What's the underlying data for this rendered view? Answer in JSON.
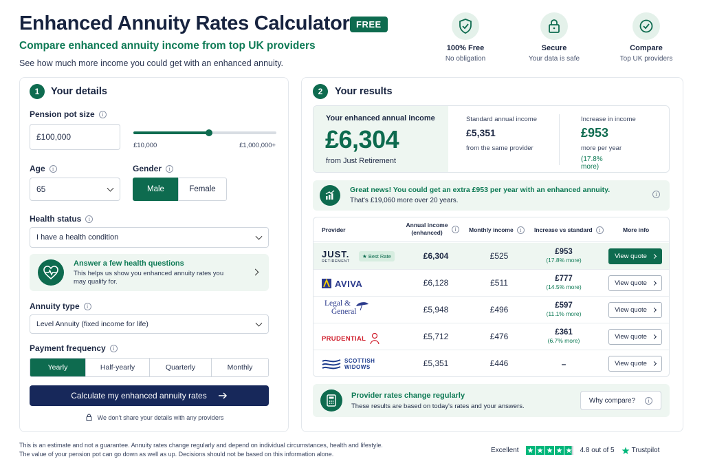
{
  "header": {
    "title": "Enhanced Annuity Rates Calculator",
    "free_badge": "FREE",
    "subtitle": "Compare enhanced annuity income from top UK providers",
    "tagline": "See how much more income you could get with an enhanced annuity."
  },
  "features": [
    {
      "title": "100% Free",
      "subtitle": "No obligation",
      "icon": "shield-check-icon"
    },
    {
      "title": "Secure",
      "subtitle": "Your data is safe",
      "icon": "lock-icon"
    },
    {
      "title": "Compare",
      "subtitle": "Top UK providers",
      "icon": "check-circle-icon"
    }
  ],
  "details": {
    "step": "1",
    "title": "Your details",
    "pension_label": "Pension pot size",
    "pension_value": "£100,000",
    "slider_min": "£10,000",
    "slider_max": "£1,000,000+",
    "slider_fraction": 0.53,
    "age_label": "Age",
    "age_value": "65",
    "gender_label": "Gender",
    "gender_options": [
      "Male",
      "Female"
    ],
    "gender_selected": "Male",
    "health_label": "Health status",
    "health_value": "I have a health condition",
    "health_card_title": "Answer a few health questions",
    "health_card_text": "This helps us show you enhanced annuity rates you may qualify for.",
    "annuity_label": "Annuity type",
    "annuity_value": "Level Annuity (fixed income for life)",
    "freq_label": "Payment frequency",
    "freq_options": [
      "Yearly",
      "Half-yearly",
      "Quarterly",
      "Monthly"
    ],
    "freq_selected": "Yearly",
    "calc_button": "Calculate my enhanced annuity rates",
    "privacy": "We don't share your details with any providers"
  },
  "results": {
    "step": "2",
    "title": "Your results",
    "enhanced_label": "Your enhanced annual income",
    "enhanced_value": "£6,304",
    "enhanced_source": "from Just Retirement",
    "standard_label": "Standard annual income",
    "standard_value": "£5,351",
    "standard_source": "from the same provider",
    "increase_label": "Increase in income",
    "increase_value": "£953",
    "increase_sub": "more per year",
    "increase_pct": "(17.8% more)",
    "news_title": "Great news! You could get an extra £953 per year with an enhanced annuity.",
    "news_sub": "That's £19,060 more over 20 years.",
    "table_headers": {
      "provider": "Provider",
      "annual": "Annual income (enhanced)",
      "monthly": "Monthly income",
      "increase": "Increase vs standard",
      "more": "More info"
    },
    "best_badge": "Best Rate",
    "rows": [
      {
        "provider": "Just Retirement",
        "logo_main": "JUST.",
        "logo_sub": "RETIREMENT",
        "annual": "£6,304",
        "monthly": "£525",
        "increase": "£953",
        "increase_pct": "(17.8% more)",
        "button": "View quote"
      },
      {
        "provider": "Aviva",
        "logo_main": "AVIVA",
        "annual": "£6,128",
        "monthly": "£511",
        "increase": "£777",
        "increase_pct": "(14.5% more)",
        "button": "View quote"
      },
      {
        "provider": "Legal & General",
        "logo_main": "Legal &",
        "logo_sub": "General",
        "annual": "£5,948",
        "monthly": "£496",
        "increase": "£597",
        "increase_pct": "(11.1% more)",
        "button": "View quote"
      },
      {
        "provider": "Prudential",
        "logo_main": "PRUDENTIAL",
        "annual": "£5,712",
        "monthly": "£476",
        "increase": "£361",
        "increase_pct": "(6.7% more)",
        "button": "View quote"
      },
      {
        "provider": "Scottish Widows",
        "logo_main": "SCOTTISH",
        "logo_sub": "WIDOWS",
        "annual": "£5,351",
        "monthly": "£446",
        "increase": "–",
        "increase_pct": "",
        "button": "View quote"
      }
    ],
    "rates_title": "Provider rates change regularly",
    "rates_sub": "These results are based on today's rates and your answers.",
    "why_button": "Why compare?"
  },
  "footer": {
    "disclaimer_1": "This is an estimate and not a guarantee. Annuity rates change regularly and depend on individual circumstances, health and lifestyle.",
    "disclaimer_2": "The value of your pension pot can go down as well as up. Decisions should not be based on this information alone.",
    "rating_word": "Excellent",
    "rating_score": "4.8 out of 5",
    "rating_value": 4.8,
    "brand": "Trustpilot"
  },
  "colors": {
    "brand_green": "#0e6b4f",
    "navy": "#17285a",
    "trust_green": "#00b67a"
  }
}
